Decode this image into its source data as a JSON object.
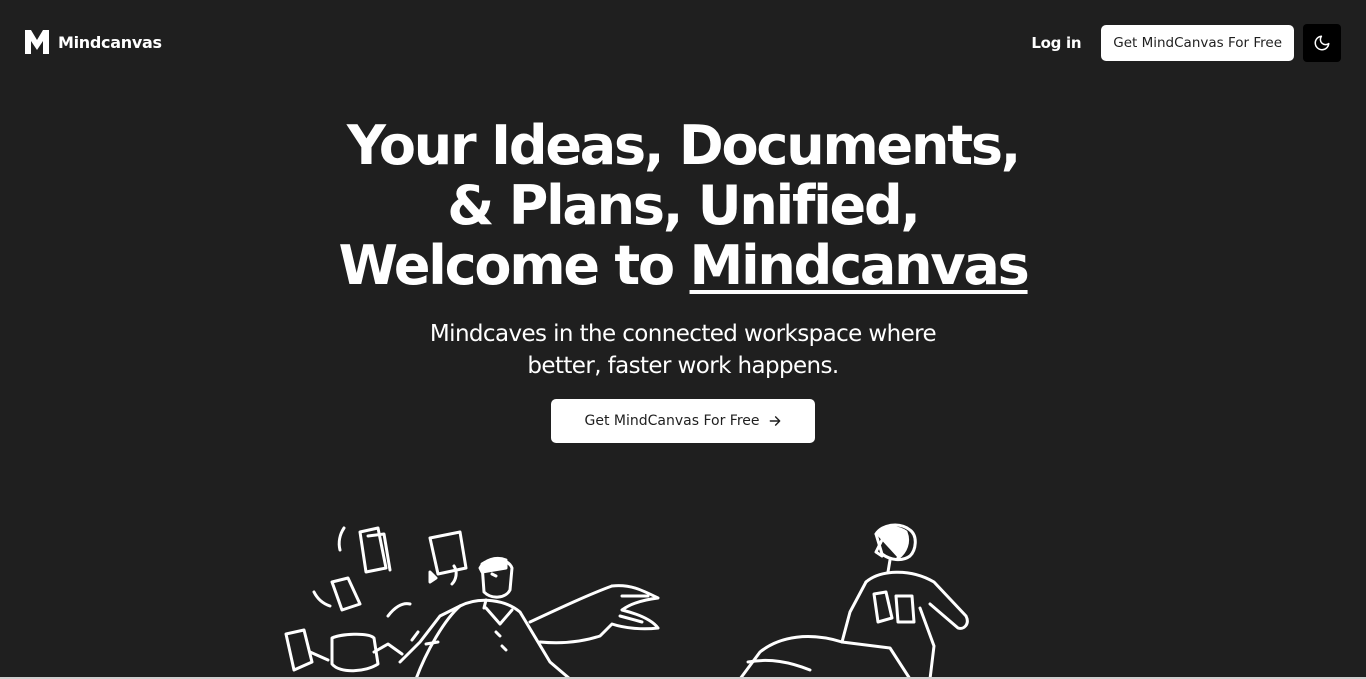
{
  "header": {
    "brand_name": "Mindcanvas",
    "login_label": "Log in",
    "cta_label": "Get MindCanvas For Free",
    "theme_toggle_icon": "moon-icon"
  },
  "hero": {
    "title_line1": "Your Ideas, Documents,",
    "title_line2": "& Plans, Unified,",
    "title_line3_prefix": "Welcome to ",
    "title_line3_highlight": "Mindcanvas",
    "subtitle_line1": "Mindcaves in the connected workspace where",
    "subtitle_line2": "better, faster work happens.",
    "cta_label": "Get MindCanvas For Free",
    "cta_icon": "arrow-right-icon"
  },
  "colors": {
    "background": "#1f1f1f",
    "text": "#ffffff",
    "button_bg": "#ffffff",
    "button_text": "#1f1f1f",
    "toggle_bg": "#000000"
  }
}
